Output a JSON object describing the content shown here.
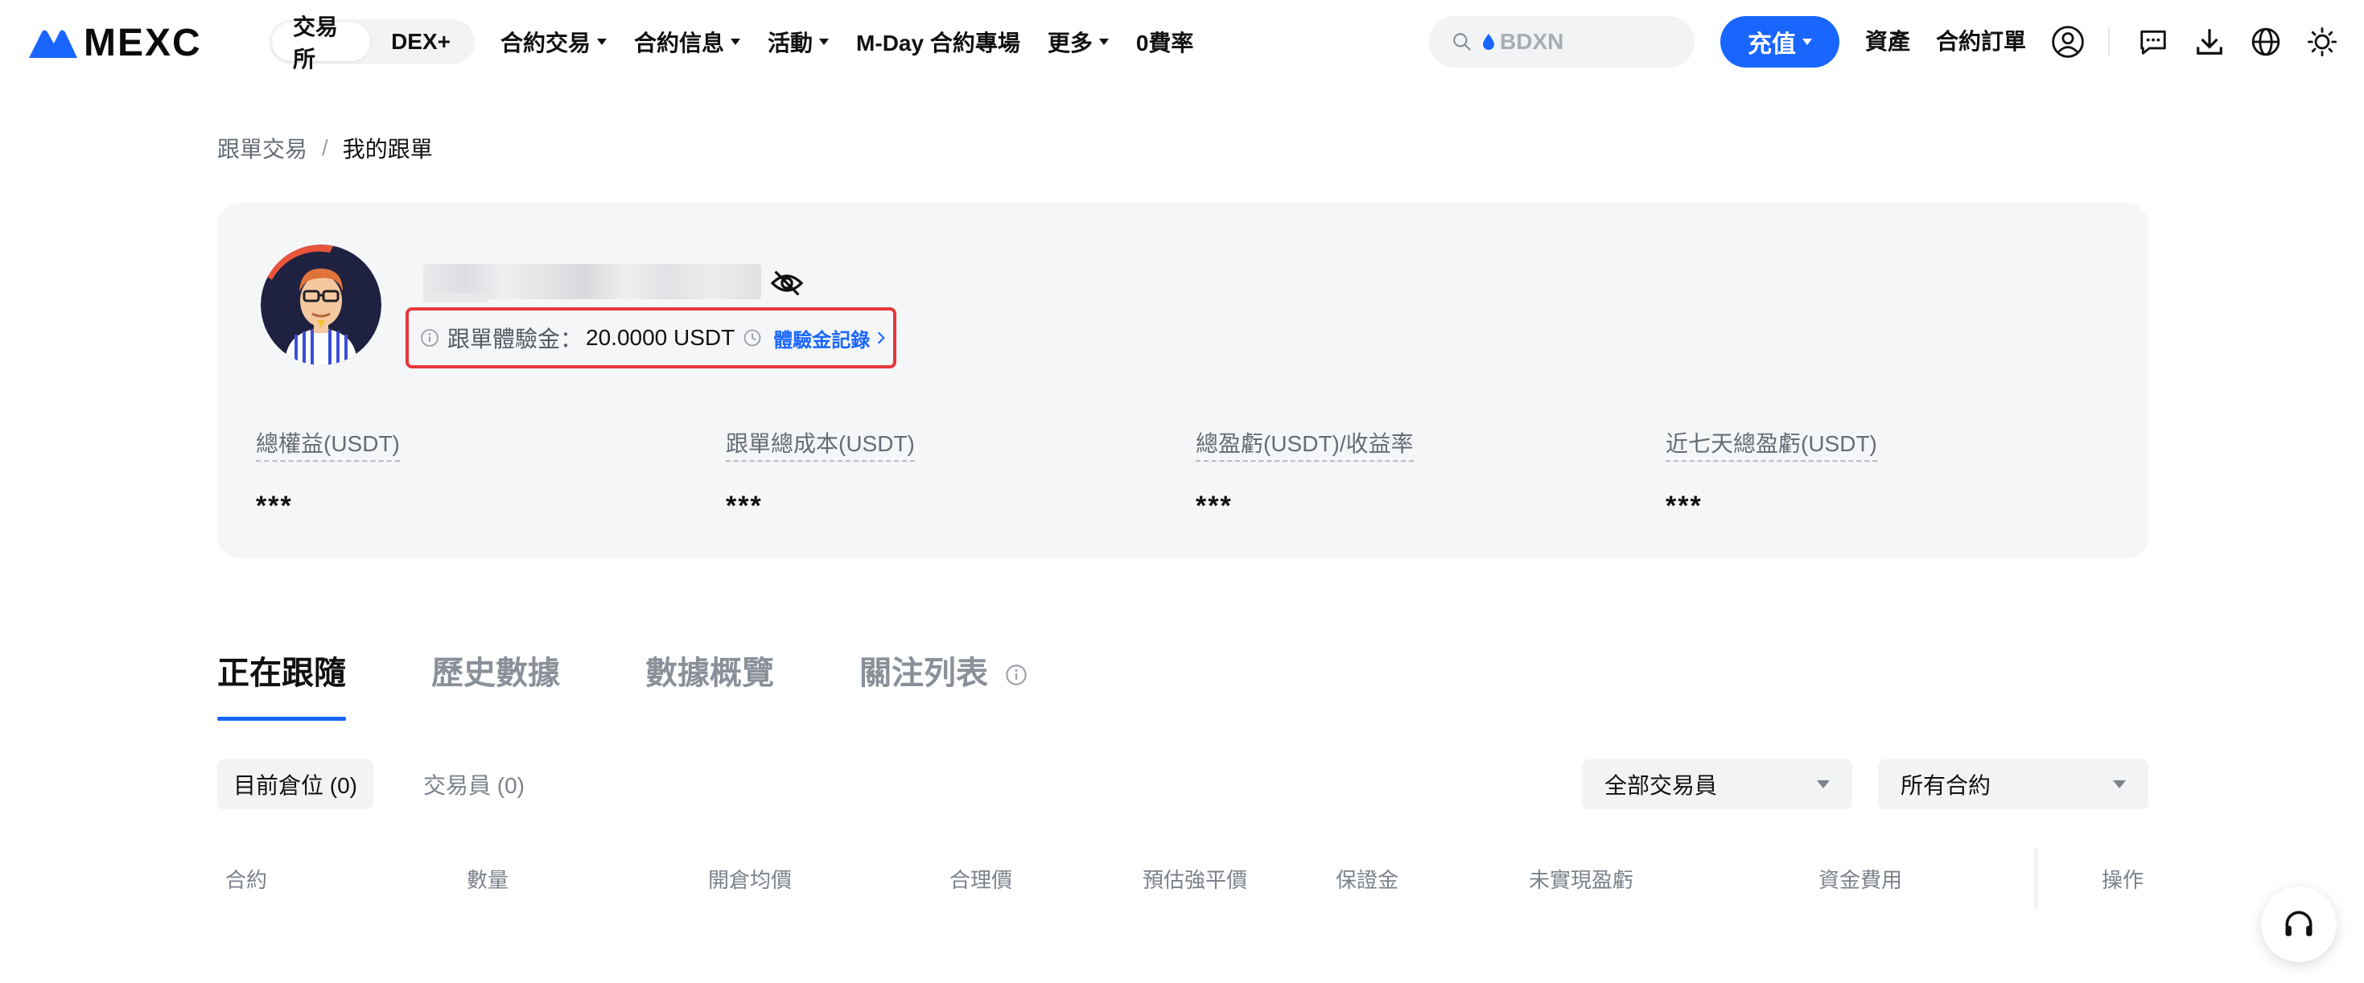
{
  "header": {
    "logo_text": "MEXC",
    "segments": [
      "交易所",
      "DEX+"
    ],
    "nav": [
      {
        "label": "合約交易",
        "has_caret": true
      },
      {
        "label": "合約信息",
        "has_caret": true
      },
      {
        "label": "活動",
        "has_caret": true
      },
      {
        "label": "M-Day 合約專場",
        "has_caret": false
      },
      {
        "label": "更多",
        "has_caret": true
      },
      {
        "label": "0費率",
        "has_caret": false
      }
    ],
    "search_placeholder": "BDXN",
    "deposit_label": "充值",
    "assets_label": "資產",
    "orders_label": "合約訂單",
    "icons": [
      "user-icon",
      "message-icon",
      "download-icon",
      "globe-icon",
      "theme-sun-icon"
    ],
    "accent_color": "#1966ff"
  },
  "breadcrumb": {
    "parent": "跟單交易",
    "separator": "/",
    "current": "我的跟單"
  },
  "profile": {
    "experience_label": "跟單體驗金：",
    "experience_value": "20.0000 USDT",
    "experience_link": "體驗金記錄",
    "stats": [
      {
        "label": "總權益(USDT)",
        "value": "***"
      },
      {
        "label": "跟單總成本(USDT)",
        "value": "***"
      },
      {
        "label": "總盈虧(USDT)/收益率",
        "value": "***"
      },
      {
        "label": "近七天總盈虧(USDT)",
        "value": "***"
      }
    ]
  },
  "tabs": [
    "正在跟隨",
    "歷史數據",
    "數據概覽",
    "關注列表"
  ],
  "filters": {
    "chips": [
      "目前倉位 (0)",
      "交易員 (0)"
    ],
    "trader_select": "全部交易員",
    "contract_select": "所有合約"
  },
  "table": {
    "columns": [
      "合約",
      "數量",
      "開倉均價",
      "合理價",
      "預估強平價",
      "保證金",
      "未實現盈虧",
      "資金費用",
      "操作"
    ]
  }
}
